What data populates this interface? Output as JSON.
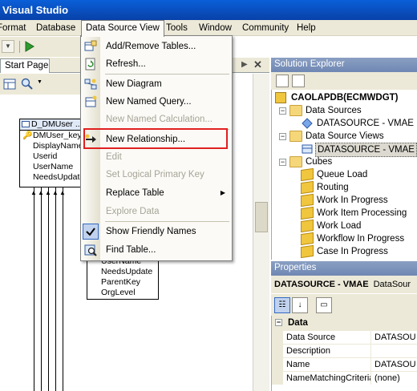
{
  "window": {
    "title": "Visual Studio"
  },
  "menubar": {
    "items": [
      "Format",
      "Database",
      "Data Source View",
      "Tools",
      "Window",
      "Community",
      "Help"
    ]
  },
  "doc_tabs": {
    "start_page": "Start Page"
  },
  "dropdown": {
    "items": [
      {
        "label": "Add/Remove Tables...",
        "enabled": true,
        "icon": "add-remove-tables-icon"
      },
      {
        "label": "Refresh...",
        "enabled": true,
        "icon": "refresh-icon"
      },
      {
        "label": "New Diagram",
        "enabled": true,
        "icon": "new-diagram-icon"
      },
      {
        "label": "New Named Query...",
        "enabled": true,
        "icon": "new-named-query-icon"
      },
      {
        "label": "New Named Calculation...",
        "enabled": false,
        "icon": ""
      },
      {
        "label": "New Relationship...",
        "enabled": true,
        "icon": "new-relationship-icon"
      },
      {
        "label": "Edit",
        "enabled": false,
        "icon": ""
      },
      {
        "label": "Set Logical Primary Key",
        "enabled": false,
        "icon": ""
      },
      {
        "label": "Replace Table",
        "enabled": true,
        "icon": "",
        "submenu": true
      },
      {
        "label": "Explore Data",
        "enabled": false,
        "icon": ""
      },
      {
        "label": "Show Friendly Names",
        "enabled": true,
        "icon": "checkmark-icon",
        "checked": true
      },
      {
        "label": "Find Table...",
        "enabled": true,
        "icon": "find-table-icon"
      }
    ]
  },
  "designer": {
    "table1": {
      "name": "D_DMUser ...",
      "columns": [
        "DMUser_key",
        "DisplayName",
        "Userid",
        "UserName",
        "NeedsUpdate"
      ]
    },
    "table2": {
      "columns": [
        "UserName",
        "NeedsUpdate",
        "ParentKey",
        "OrgLevel"
      ]
    }
  },
  "solution_explorer": {
    "title": "Solution Explorer",
    "project": "CAOLAPDB(ECMWDGT)",
    "data_sources_label": "Data Sources",
    "data_source_item": "DATASOURCE - VMAE",
    "dsv_label": "Data Source Views",
    "dsv_item": "DATASOURCE - VMAE",
    "cubes_label": "Cubes",
    "cubes": [
      "Queue Load",
      "Routing",
      "Work In Progress",
      "Work Item Processing",
      "Work Load",
      "Workflow In Progress",
      "Case In Progress"
    ]
  },
  "properties": {
    "title": "Properties",
    "object_name": "DATASOURCE - VMAE",
    "object_type": "DataSour",
    "category": "Data",
    "rows": [
      {
        "key": "Data Source",
        "value": "DATASOU"
      },
      {
        "key": "Description",
        "value": ""
      },
      {
        "key": "Name",
        "value": "DATASOU"
      },
      {
        "key": "NameMatchingCriteria",
        "value": "(none)"
      }
    ]
  }
}
